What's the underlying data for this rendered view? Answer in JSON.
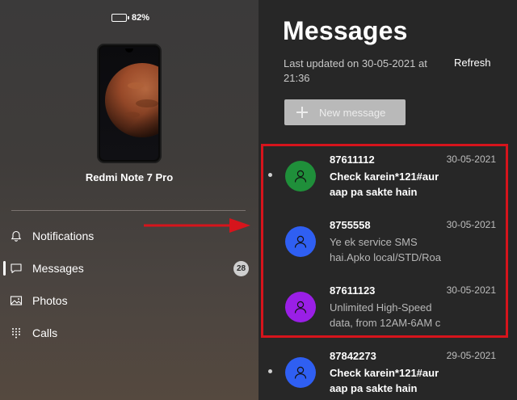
{
  "device": {
    "battery_percent_label": "82%",
    "battery_level": 0.82,
    "name": "Redmi Note 7 Pro"
  },
  "nav": {
    "items": [
      {
        "label": "Notifications",
        "icon": "bell-icon"
      },
      {
        "label": "Messages",
        "icon": "chat-bubble-icon",
        "badge": "28",
        "active": true
      },
      {
        "label": "Photos",
        "icon": "image-icon"
      },
      {
        "label": "Calls",
        "icon": "dialpad-icon"
      }
    ]
  },
  "messages_panel": {
    "title": "Messages",
    "last_updated": "Last updated on 30-05-2021 at 21:36",
    "refresh_label": "Refresh",
    "new_message_label": "New message"
  },
  "messages": [
    {
      "sender": "87611112",
      "date": "30-05-2021",
      "preview": "Check karein*121#aur aap pa sakte hain",
      "unread": true,
      "avatar_color": "#1f8f3a"
    },
    {
      "sender": "8755558",
      "date": "30-05-2021",
      "preview": "Ye ek service SMS hai.Apko local/STD/Roa",
      "unread": false,
      "avatar_color": "#2f5ff2"
    },
    {
      "sender": "87611123",
      "date": "30-05-2021",
      "preview": "Unlimited High-Speed data, from 12AM-6AM c",
      "unread": false,
      "avatar_color": "#9a1fe6"
    },
    {
      "sender": "87842273",
      "date": "29-05-2021",
      "preview": "Check karein*121#aur aap pa sakte hain",
      "unread": true,
      "avatar_color": "#2f5ff2"
    }
  ],
  "colors": {
    "annotation_red": "#d6141c"
  }
}
